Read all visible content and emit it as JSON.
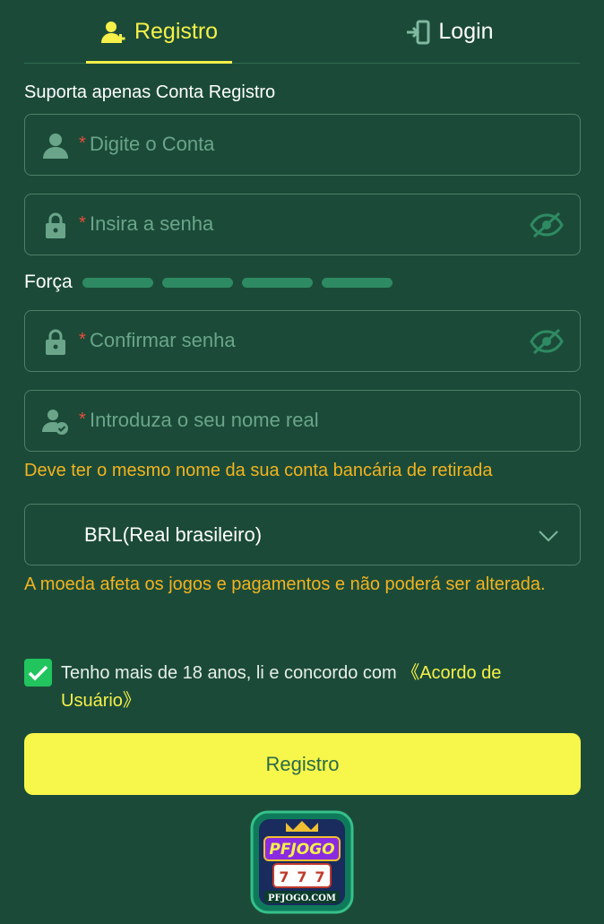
{
  "tabs": [
    {
      "label": "Registro",
      "icon": "add-user-icon",
      "active": true
    },
    {
      "label": "Login",
      "icon": "login-door-icon",
      "active": false
    }
  ],
  "form": {
    "support_text": "Suporta apenas Conta Registro",
    "account_placeholder": "Digite o Conta",
    "password_placeholder": "Insira a senha",
    "strength_label": "Força",
    "confirm_placeholder": "Confirmar senha",
    "realname_placeholder": "Introduza o seu nome real",
    "realname_note": "Deve ter o mesmo nome da sua conta bancária de retirada",
    "currency_value": "BRL(Real brasileiro)",
    "currency_note": "A moeda afeta os jogos e pagamentos e não poderá ser alterada.",
    "required_mark": "*"
  },
  "terms": {
    "checked": true,
    "text": "Tenho mais de 18 anos, li e concordo com ",
    "link": "《Acordo de Usuário》"
  },
  "submit_label": "Registro",
  "logo": {
    "text": "PFJOGO",
    "domain": "PFJOGO.COM"
  },
  "colors": {
    "background": "#1b4b38",
    "accent": "#f5f04a",
    "warning": "#f2b320",
    "strength_bar": "#2e8a62",
    "checkbox": "#22c45e"
  }
}
